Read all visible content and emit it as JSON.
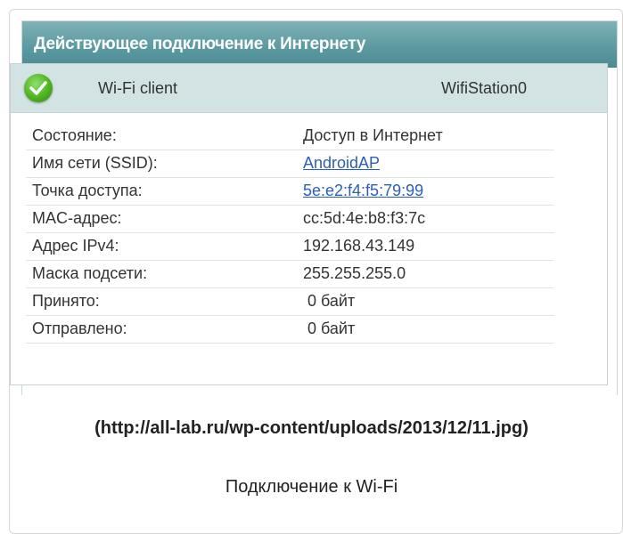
{
  "panel": {
    "title": "Действующее подключение к Интернету"
  },
  "connection": {
    "type": "Wi-Fi client",
    "interface": "WifiStation0",
    "status_icon": "check-icon",
    "rows": [
      {
        "label": "Состояние:",
        "value": "Доступ в Интернет"
      },
      {
        "label": "Имя сети (SSID):",
        "value": "AndroidAP"
      },
      {
        "label": "Точка доступа:",
        "value": "5e:e2:f4:f5:79:99"
      },
      {
        "label": "MAC-адрес:",
        "value": "cc:5d:4e:b8:f3:7c"
      },
      {
        "label": "Адрес IPv4:",
        "value": "192.168.43.149"
      },
      {
        "label": "Маска подсети:",
        "value": "255.255.255.0"
      },
      {
        "label": "Принято:",
        "value": "0 байт"
      },
      {
        "label": "Отправлено:",
        "value": "0 байт"
      }
    ]
  },
  "source_text": "(http://all-lab.ru/wp-content/uploads/2013/12/11.jpg)",
  "caption": "Подключение к Wi-Fi",
  "colors": {
    "header": "#5d9ba2",
    "conn_head": "#d3e2e3",
    "link": "#2b5fb8",
    "status_ok": "#4db31f"
  }
}
